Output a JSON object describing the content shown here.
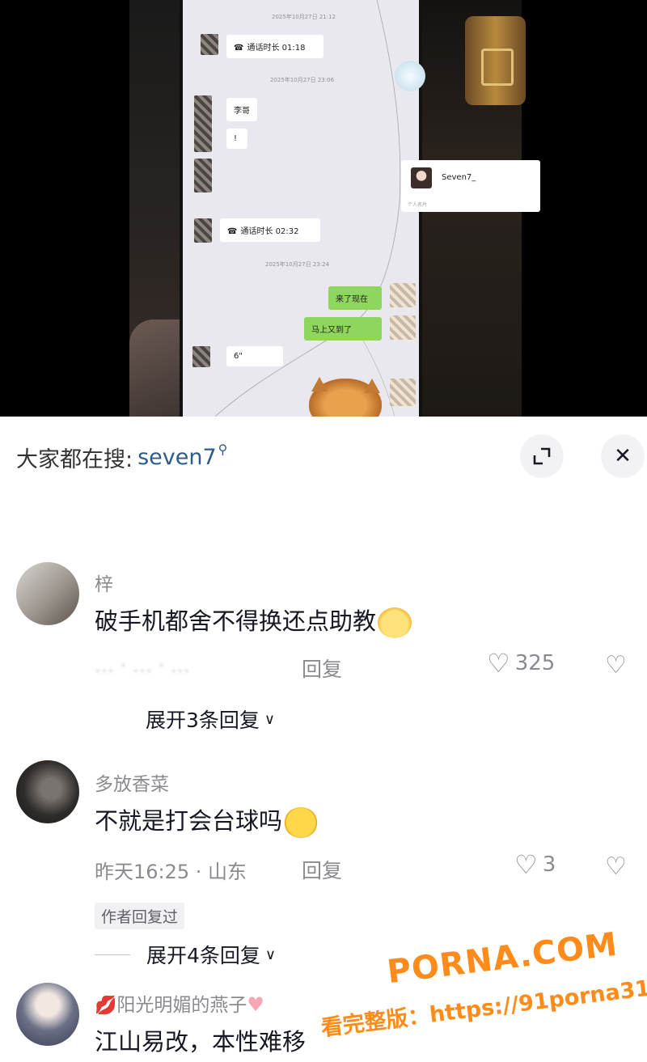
{
  "video": {
    "chat": {
      "timestamp_1": "2025年10月27日 21:12",
      "call_1": "通话时长 01:18",
      "timestamp_2": "2025年10月27日 23:06",
      "msg_lige": "李哥",
      "msg_exclaim": "!",
      "card_name": "Seven7_",
      "card_label": "个人名片",
      "call_2": "通话时长 02:32",
      "timestamp_3": "2025年10月27日 23:24",
      "msg_come": "来了现在",
      "msg_soon": "马上又到了",
      "msg_six": "6\""
    }
  },
  "search": {
    "prefix": "大家都在搜:",
    "term": "seven7",
    "icon": "search-icon"
  },
  "buttons": {
    "expand_icon": "expand-icon",
    "close_icon": "close-icon"
  },
  "comments": [
    {
      "name": "梓",
      "text": "破手机都舍不得换还点助教",
      "meta_blurred": "… · … · … ",
      "reply": "回复",
      "likes": "325",
      "expand": "展开3条回复"
    },
    {
      "name": "多放香菜",
      "text": "不就是打会台球吗",
      "meta": "昨天16:25 · 山东",
      "reply": "回复",
      "likes": "3",
      "author_tag": "作者回复过",
      "expand": "展开4条回复"
    },
    {
      "name": "阳光明媚的燕子",
      "text": "江山易改，本性难移"
    }
  ],
  "watermark": {
    "brand": "PORNA.COM",
    "line": "看完整版：https://91porna31.com"
  },
  "colors": {
    "search_term": "#2b5c8f",
    "watermark": "#ff8b1a",
    "chat_green": "#8fd65e"
  }
}
